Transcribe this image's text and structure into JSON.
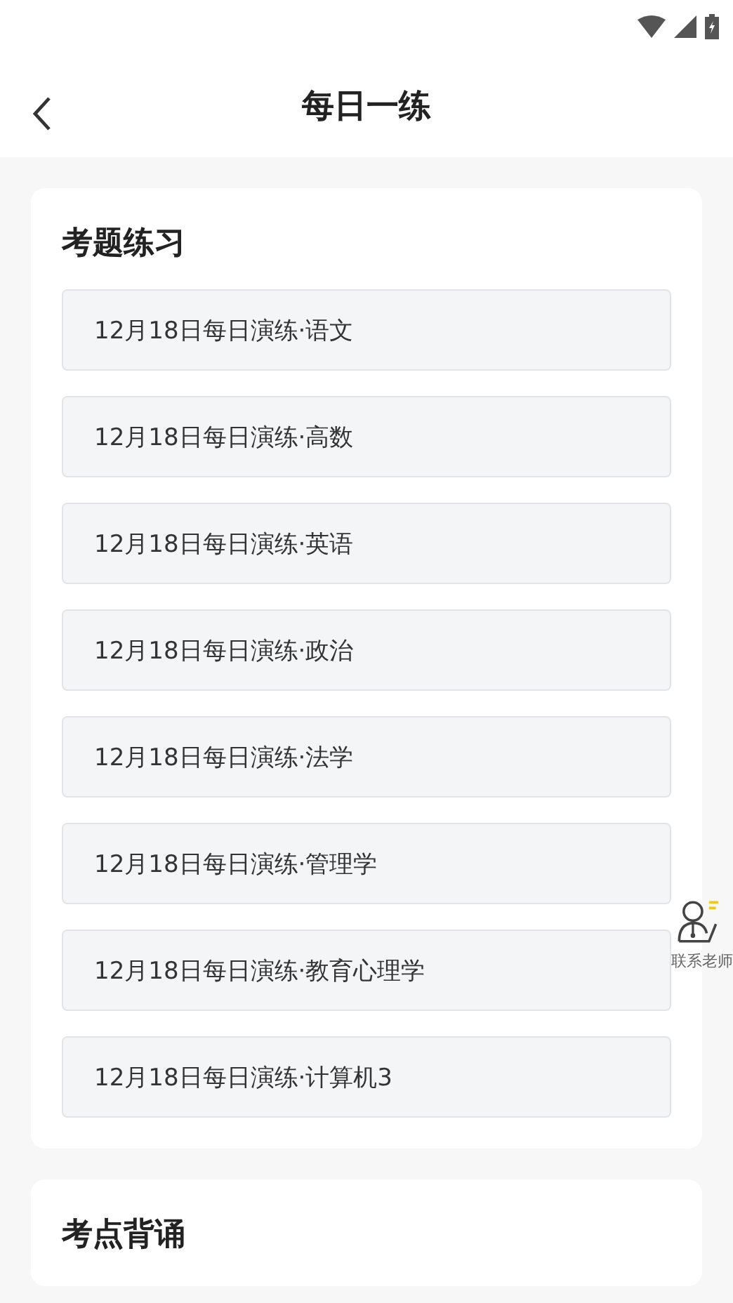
{
  "header": {
    "title": "每日一练"
  },
  "sections": [
    {
      "title": "考题练习",
      "items": [
        {
          "label": "12月18日每日演练·语文"
        },
        {
          "label": "12月18日每日演练·高数"
        },
        {
          "label": "12月18日每日演练·英语"
        },
        {
          "label": "12月18日每日演练·政治"
        },
        {
          "label": "12月18日每日演练·法学"
        },
        {
          "label": "12月18日每日演练·管理学"
        },
        {
          "label": "12月18日每日演练·教育心理学"
        },
        {
          "label": "12月18日每日演练·计算机3"
        }
      ]
    },
    {
      "title": "考点背诵"
    }
  ],
  "contact": {
    "label": "联系老师"
  }
}
